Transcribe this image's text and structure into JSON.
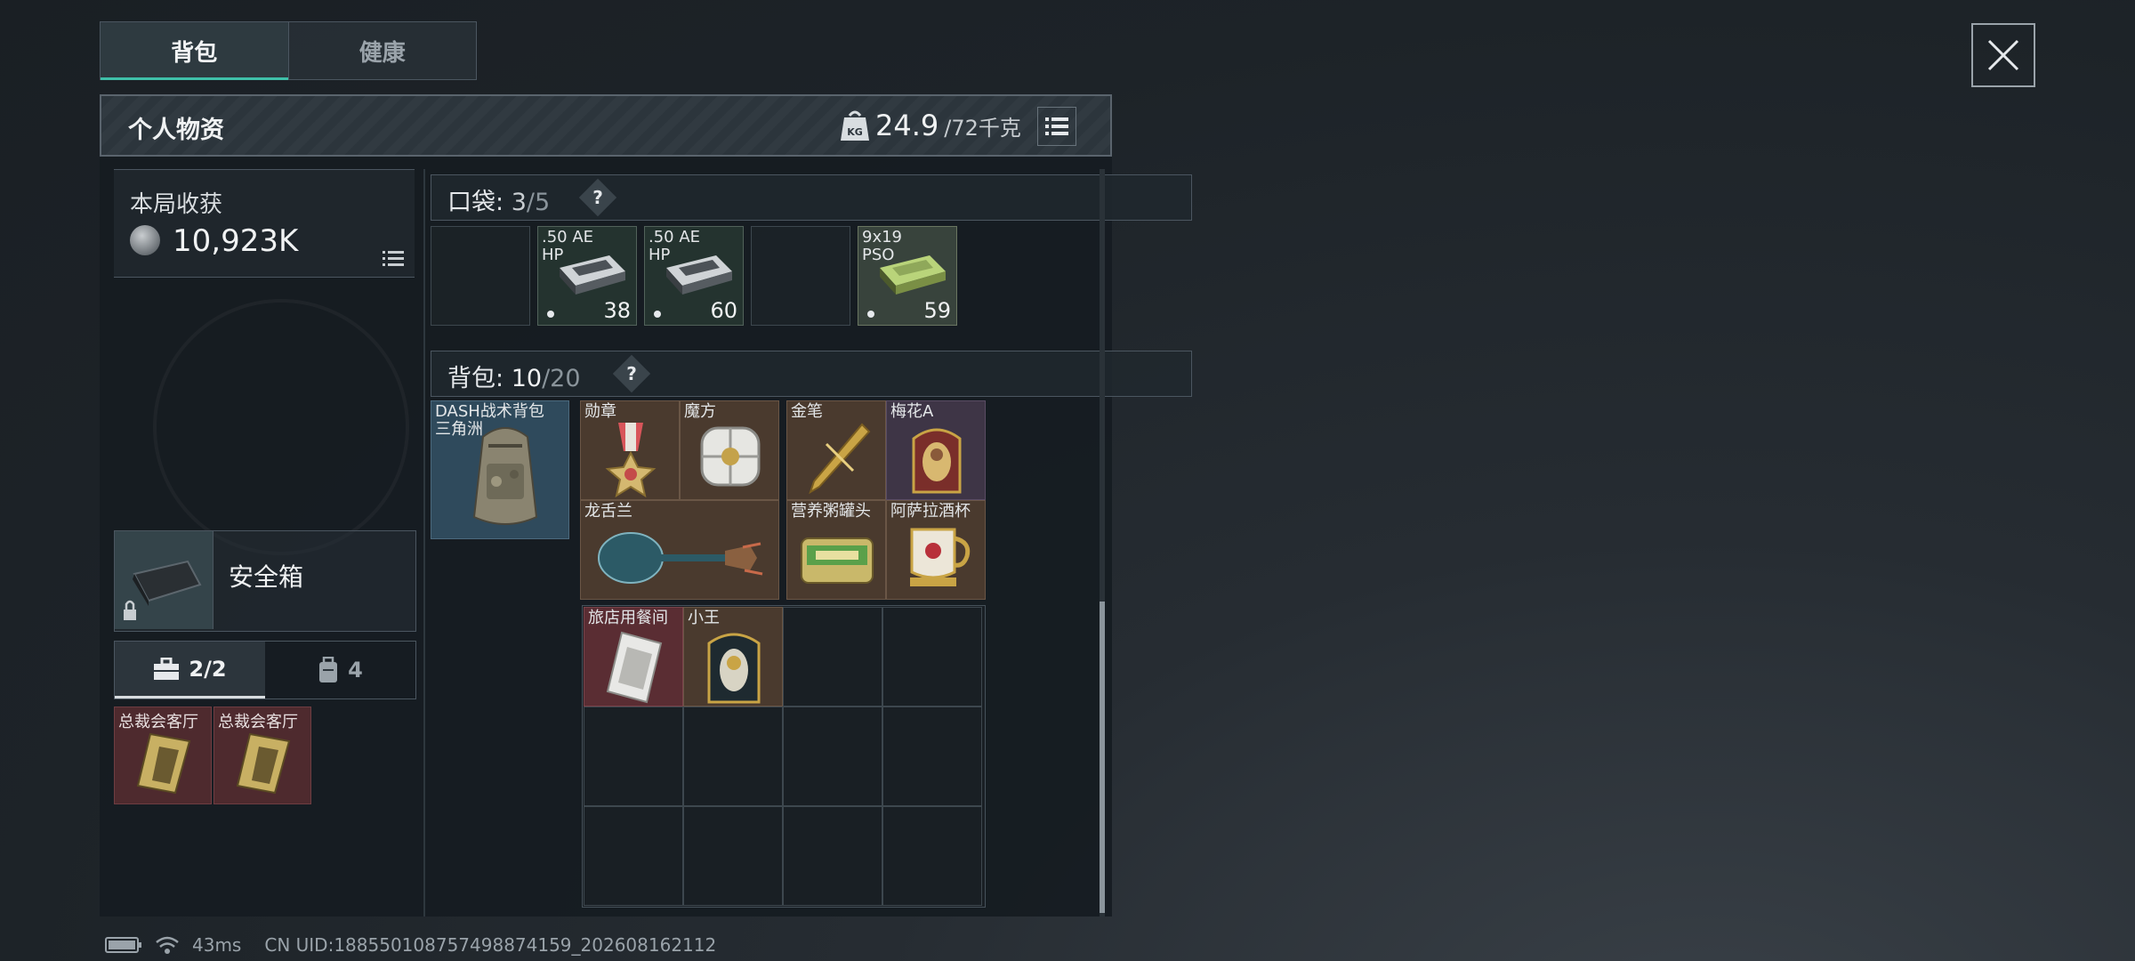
{
  "tabs": [
    {
      "label": "背包",
      "active": true
    },
    {
      "label": "健康",
      "active": false
    }
  ],
  "panel": {
    "title": "个人物资",
    "weight_current": "24.9",
    "weight_max": "/72千克",
    "weight_icon": "kg-weight-icon",
    "list_icon": "list-icon"
  },
  "harvest": {
    "label": "本局收获",
    "value": "10,923K",
    "icon": "coin-icon"
  },
  "safebox": {
    "label": "安全箱",
    "locked": true
  },
  "subtabs": [
    {
      "label": "2/2",
      "icon": "toolbox-icon",
      "active": true
    },
    {
      "label": "4",
      "icon": "backpack-icon",
      "active": false
    }
  ],
  "key_cards": [
    {
      "name": "总裁会客厅"
    },
    {
      "name": "总裁会客厅"
    }
  ],
  "pocket": {
    "label": "口袋:",
    "count": "3",
    "total": "/5",
    "help": "?",
    "slots": [
      {
        "type": "empty"
      },
      {
        "type": "item",
        "name": ".50 AE HP",
        "qty": "38"
      },
      {
        "type": "item",
        "name": ".50 AE HP",
        "qty": "60"
      },
      {
        "type": "empty"
      },
      {
        "type": "item",
        "name": "9x19 PSO",
        "qty": "59"
      }
    ]
  },
  "backpack": {
    "label": "背包:",
    "count": "10",
    "total": "/20",
    "help": "?",
    "bag_name": "DASH战术背包",
    "bag_sub": "三角洲",
    "items": [
      {
        "name": "勋章"
      },
      {
        "name": "魔方"
      },
      {
        "name": "金笔"
      },
      {
        "name": "梅花A"
      },
      {
        "name": "龙舌兰"
      },
      {
        "name": "营养粥罐头"
      },
      {
        "name": "阿萨拉酒杯"
      },
      {
        "name": "旅店用餐间"
      },
      {
        "name": "小王"
      }
    ]
  },
  "status": {
    "ping": "43ms",
    "uid": "CN UID:1885501087574988741​59_202608162112"
  }
}
